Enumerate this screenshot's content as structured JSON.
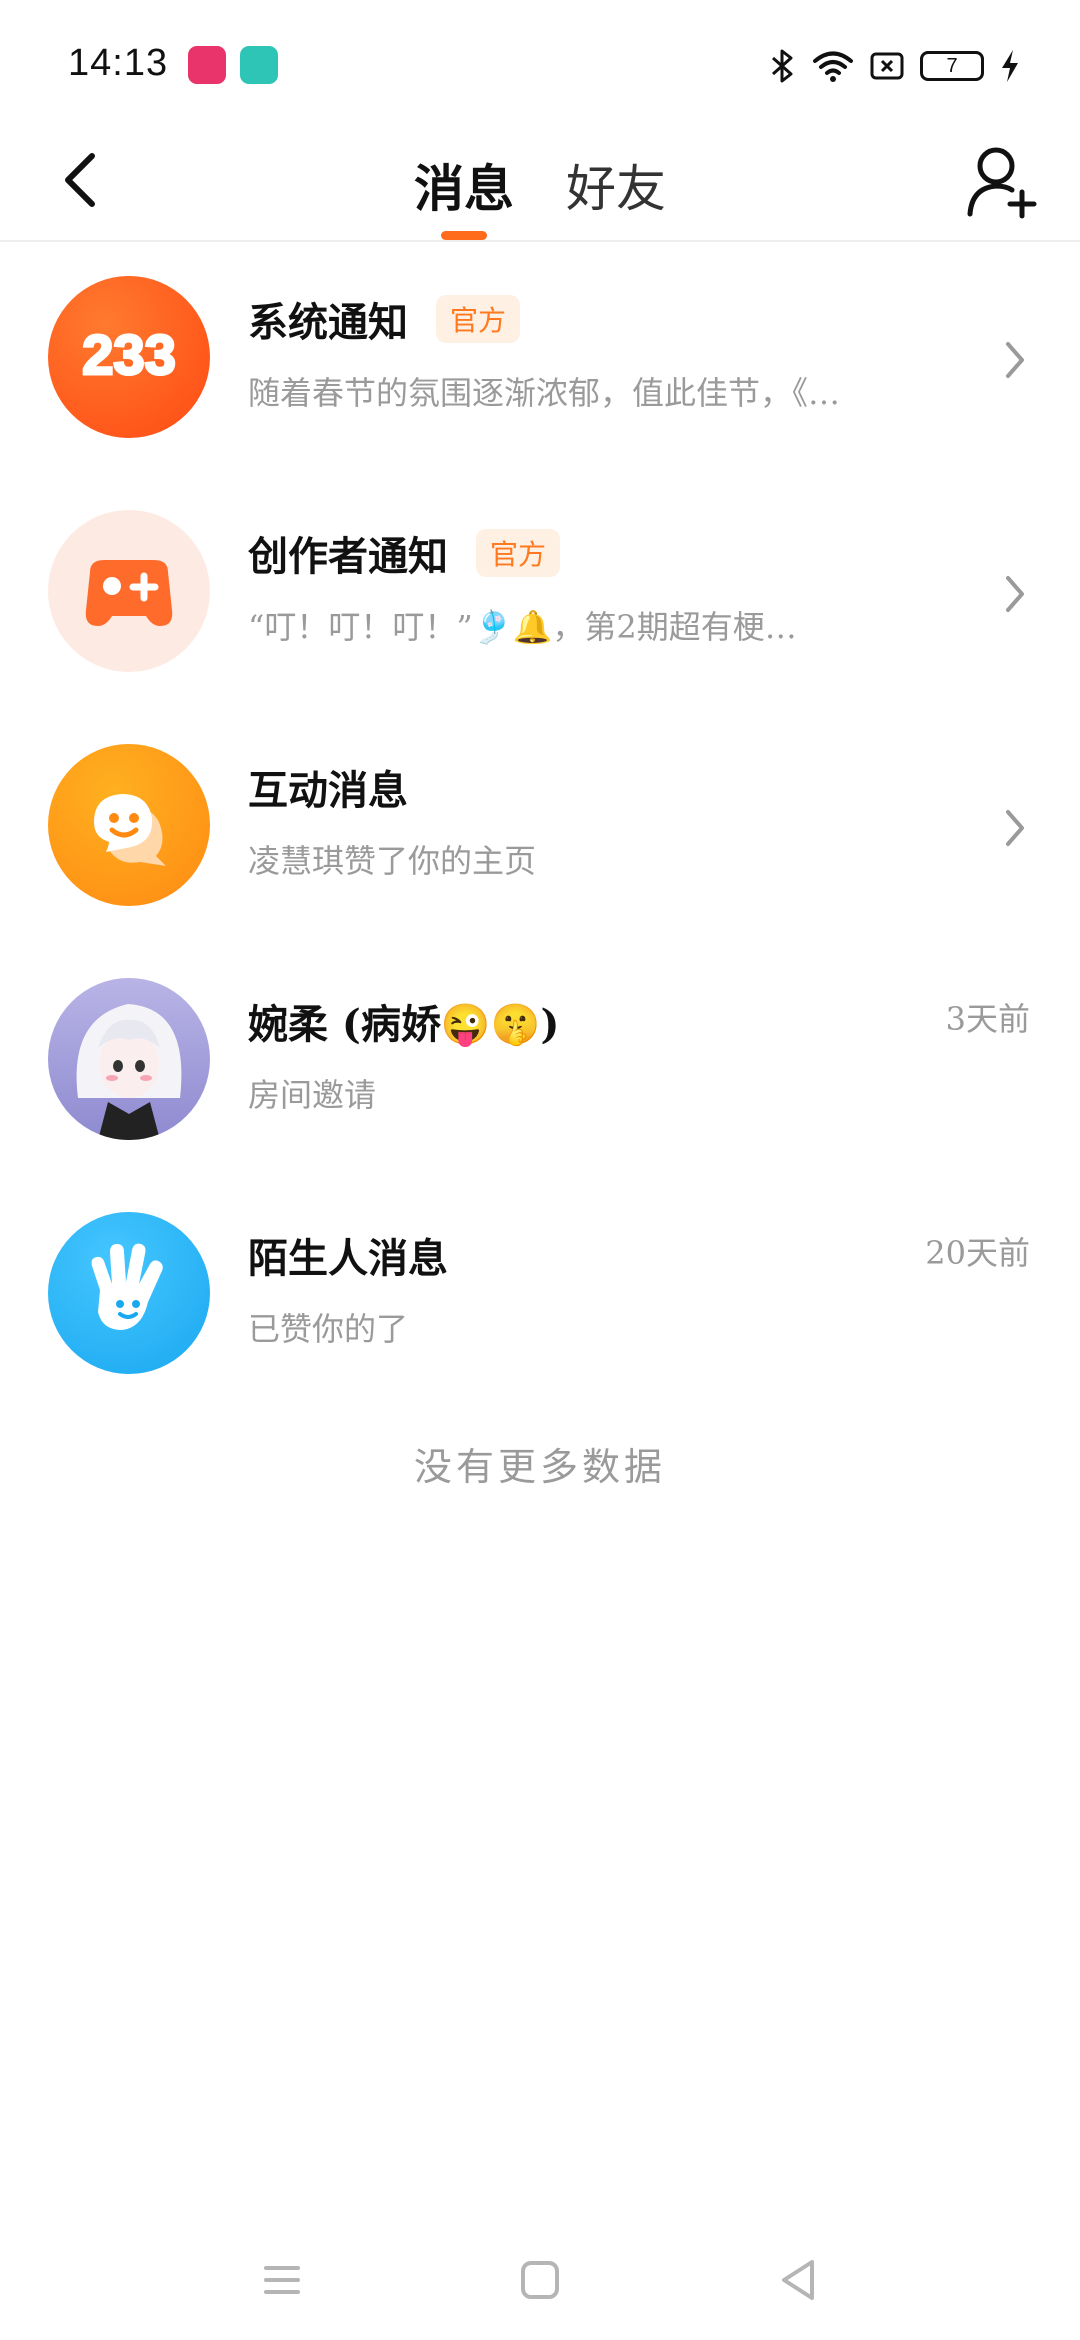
{
  "status_bar": {
    "time": "14:13",
    "battery_level": "7",
    "icons": [
      "app-icon-video",
      "app-icon-chat",
      "bluetooth-icon",
      "wifi-icon",
      "sim-icon",
      "battery-icon",
      "charging-icon"
    ]
  },
  "header": {
    "tabs": [
      {
        "label": "消息",
        "active": true
      },
      {
        "label": "好友",
        "active": false
      }
    ],
    "accent_color": "#ff6b1a"
  },
  "messages": [
    {
      "title": "系统通知",
      "badge": "官方",
      "subtitle": "随着春节的氛围逐渐浓郁，值此佳节，《…",
      "time": "",
      "has_chevron": true,
      "avatar": "233-logo-icon"
    },
    {
      "title": "创作者通知",
      "badge": "官方",
      "subtitle": "“叮！叮！叮！”🎐🔔，第2期超有梗…",
      "time": "",
      "has_chevron": true,
      "avatar": "gamepad-icon"
    },
    {
      "title": "互动消息",
      "badge": "",
      "subtitle": "凌慧琪赞了你的主页",
      "time": "",
      "has_chevron": true,
      "avatar": "chat-face-icon"
    },
    {
      "title": "婉柔 (病娇😜🤫)",
      "badge": "",
      "subtitle": "房间邀请",
      "time": "3天前",
      "has_chevron": false,
      "avatar": "user-avatar"
    },
    {
      "title": "陌生人消息",
      "badge": "",
      "subtitle": "已赞你的了",
      "time": "20天前",
      "has_chevron": false,
      "avatar": "wave-hand-icon"
    }
  ],
  "footer_text": "没有更多数据"
}
